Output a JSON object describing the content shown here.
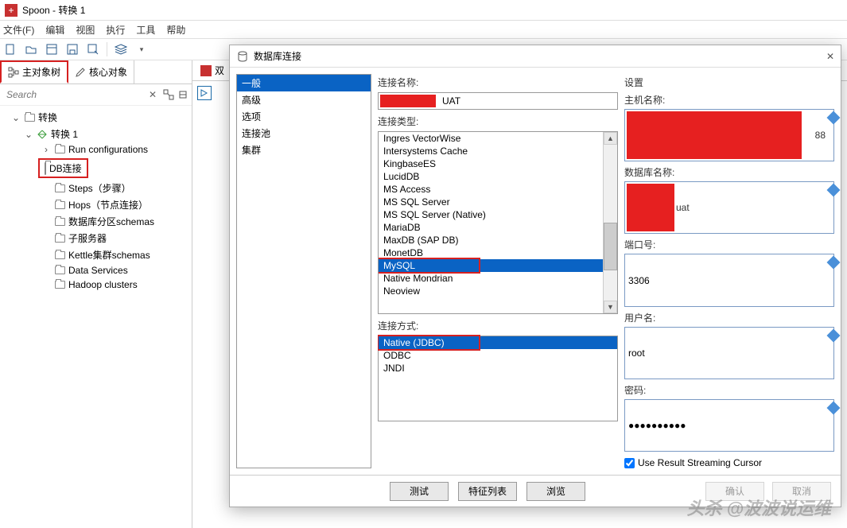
{
  "window": {
    "title": "Spoon - 转换 1"
  },
  "menu": {
    "file": "文件(F)",
    "edit": "编辑",
    "view": "视图",
    "exec": "执行",
    "tools": "工具",
    "help": "帮助"
  },
  "tabs": {
    "main_tree": "主对象树",
    "core_objs": "核心对象"
  },
  "search": {
    "placeholder": "Search"
  },
  "tree": {
    "root": "转换",
    "t1": "转换 1",
    "run_cfg": "Run configurations",
    "db_conn": "DB连接",
    "steps": "Steps（步骤）",
    "hops": "Hops（节点连接）",
    "schemas": "数据库分区schemas",
    "childsrv": "子服务器",
    "kettle": "Kettle集群schemas",
    "datasvc": "Data Services",
    "hadoop": "Hadoop clusters"
  },
  "canvas": {
    "tab1_prefix": "双"
  },
  "dialog": {
    "title": "数据库连接",
    "categories": [
      "一般",
      "高级",
      "选项",
      "连接池",
      "集群"
    ],
    "conn_name_label": "连接名称:",
    "conn_name_suffix": "UAT",
    "conn_type_label": "连接类型:",
    "conn_types": [
      "Ingres VectorWise",
      "Intersystems Cache",
      "KingbaseES",
      "LucidDB",
      "MS Access",
      "MS SQL Server",
      "MS SQL Server (Native)",
      "MariaDB",
      "MaxDB (SAP DB)",
      "MonetDB",
      "MySQL",
      "Native Mondrian",
      "Neoview"
    ],
    "conn_mode_label": "连接方式:",
    "conn_modes": [
      "Native (JDBC)",
      "ODBC",
      "JNDI"
    ],
    "settings_label": "设置",
    "host_label": "主机名称:",
    "host_suffix": "88",
    "db_label": "数据库名称:",
    "db_suffix": "uat",
    "port_label": "端口号:",
    "port_value": "3306",
    "user_label": "用户名:",
    "user_value": "root",
    "pwd_label": "密码:",
    "pwd_value": "●●●●●●●●●●",
    "cursor_chk": "Use Result Streaming Cursor",
    "btn_test": "测试",
    "btn_feat": "特征列表",
    "btn_browse": "浏览",
    "btn_ok": "确认",
    "btn_cancel": "取消"
  },
  "watermark": "头杀 @波波说运维"
}
